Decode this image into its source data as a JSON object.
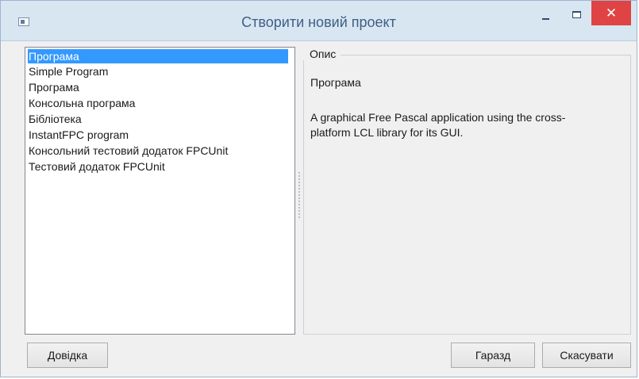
{
  "window": {
    "title": "Створити новий проект"
  },
  "controls": {
    "minimize_icon": "minimize-icon",
    "maximize_icon": "maximize-icon",
    "close_glyph": "✕",
    "close_color": "#e04343"
  },
  "list": {
    "selected_index": 0,
    "selection_color": "#3399ff",
    "items": [
      "Програма",
      "Simple Program",
      "Програма",
      "Консольна програма",
      "Бібліотека",
      "InstantFPC program",
      "Консольний тестовий додаток FPCUnit",
      "Тестовий додаток FPCUnit"
    ]
  },
  "description": {
    "legend": "Опис",
    "name": "Програма",
    "text": "A graphical Free Pascal application using the cross-platform LCL library for its GUI."
  },
  "buttons": {
    "help": "Довідка",
    "ok": "Гаразд",
    "cancel": "Скасувати"
  }
}
